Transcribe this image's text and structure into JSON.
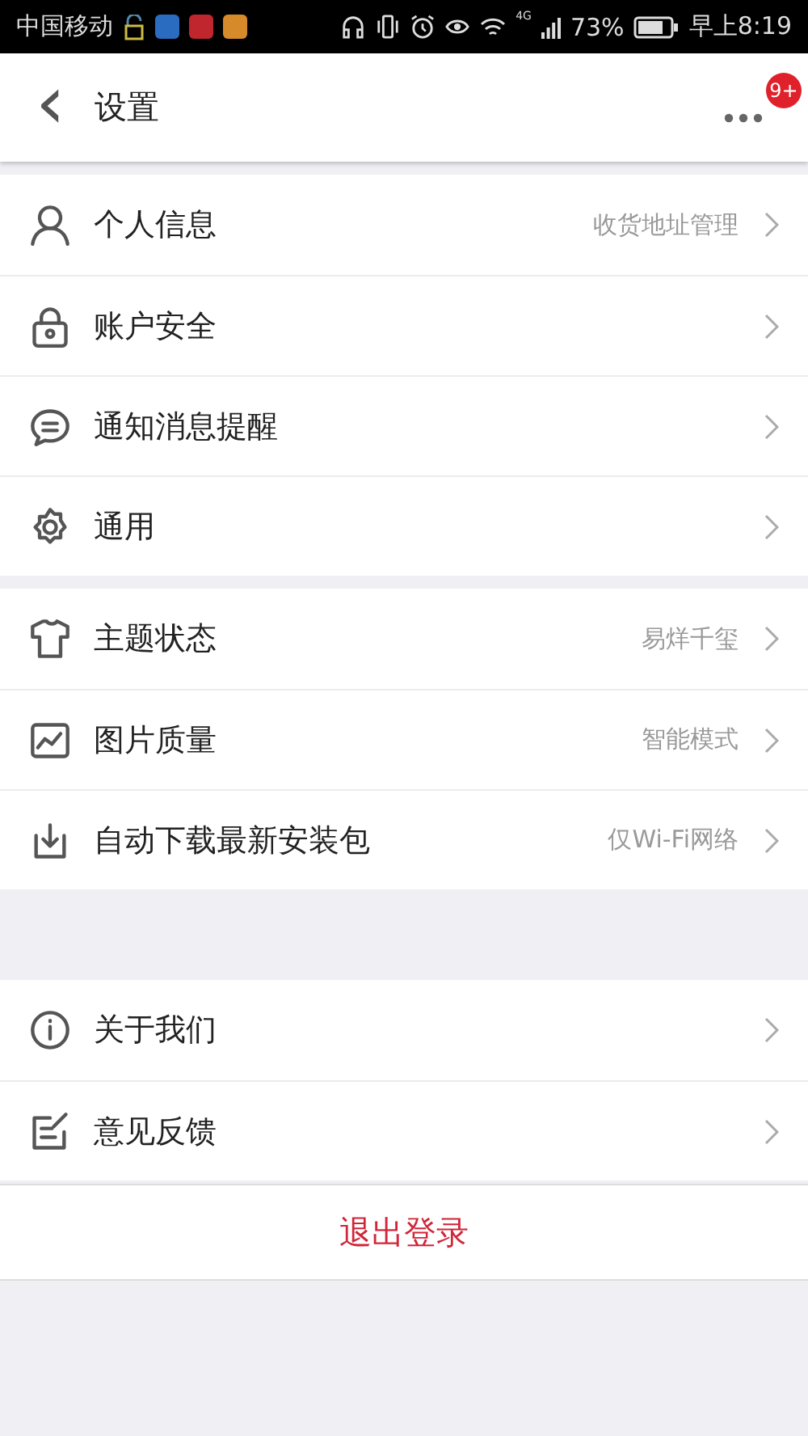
{
  "status_bar": {
    "carrier": "中国移动",
    "network": "4G",
    "battery": "73%",
    "time": "早上8:19"
  },
  "header": {
    "back": "‹",
    "title": "设置",
    "badge": "9+"
  },
  "groups": [
    {
      "items": [
        {
          "label": "个人信息",
          "value": "收货地址管理"
        },
        {
          "label": "账户安全"
        },
        {
          "label": "通知消息提醒"
        },
        {
          "label": "通用"
        }
      ]
    },
    {
      "items": [
        {
          "label": "主题状态",
          "value": "易烊千玺"
        },
        {
          "label": "图片质量",
          "value": "智能模式"
        },
        {
          "label": "自动下载最新安装包",
          "value": "仅Wi-Fi网络"
        }
      ]
    },
    {
      "items": [
        {
          "label": "关于我们"
        },
        {
          "label": "意见反馈"
        }
      ]
    }
  ],
  "logout": "退出登录"
}
